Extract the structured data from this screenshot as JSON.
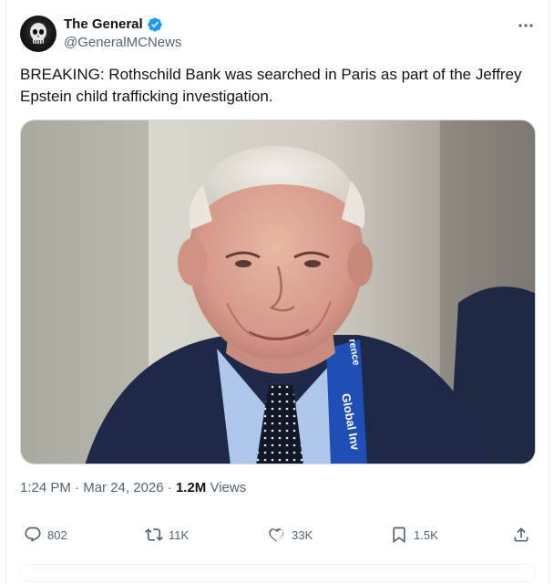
{
  "author": {
    "name": "The General",
    "handle": "@GeneralMCNews",
    "avatar_icon": "skull-avatar",
    "verified_icon": "verified-badge-icon",
    "verified_color": "#1d9bf0"
  },
  "tweet": {
    "text": "BREAKING: Rothschild Bank was searched in Paris as part of the Jeffrey Epstein child trafficking investigation.",
    "media": {
      "lanyard_text": "Global Inv",
      "lanyard_text_2": "rence"
    },
    "time": "1:24 PM",
    "date": "Mar 24, 2026",
    "views_count": "1.2M",
    "views_label": "Views"
  },
  "actions": {
    "replies": "802",
    "reposts": "11K",
    "likes": "33K",
    "bookmarks": "1.5K",
    "icons": [
      "reply-icon",
      "repost-icon",
      "like-icon",
      "bookmark-icon",
      "share-icon"
    ]
  },
  "colors": {
    "text_primary": "#0f1419",
    "text_secondary": "#536471",
    "border": "#cfd9de"
  }
}
